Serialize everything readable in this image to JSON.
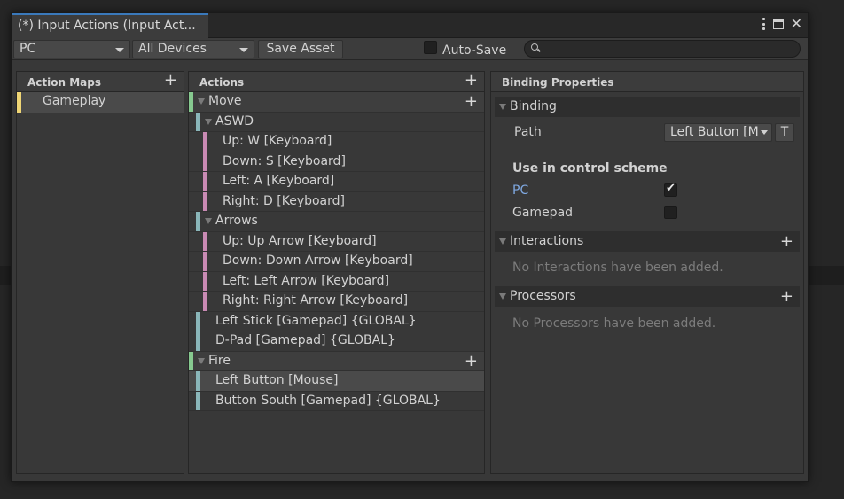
{
  "window": {
    "tab_title": "(*) Input Actions (Input Act..."
  },
  "toolbar": {
    "scheme_value": "PC",
    "device_value": "All Devices",
    "save_label": "Save Asset",
    "autosave_label": "Auto-Save",
    "autosave_checked": false
  },
  "action_maps": {
    "header": "Action Maps",
    "items": [
      {
        "label": "Gameplay",
        "color": "#f0d675"
      }
    ]
  },
  "actions": {
    "header": "Actions",
    "rows": [
      {
        "label": "Move",
        "kind": "action",
        "color": "#86c98f"
      },
      {
        "label": "ASWD",
        "kind": "composite",
        "color": "#8ab6b9"
      },
      {
        "label": "Up: W [Keyboard]",
        "kind": "part",
        "color": "#c98ab4"
      },
      {
        "label": "Down: S [Keyboard]",
        "kind": "part",
        "color": "#c98ab4"
      },
      {
        "label": "Left: A [Keyboard]",
        "kind": "part",
        "color": "#c98ab4"
      },
      {
        "label": "Right: D [Keyboard]",
        "kind": "part",
        "color": "#c98ab4"
      },
      {
        "label": "Arrows",
        "kind": "composite",
        "color": "#8ab6b9"
      },
      {
        "label": "Up: Up Arrow [Keyboard]",
        "kind": "part",
        "color": "#c98ab4"
      },
      {
        "label": "Down: Down Arrow [Keyboard]",
        "kind": "part",
        "color": "#c98ab4"
      },
      {
        "label": "Left: Left Arrow [Keyboard]",
        "kind": "part",
        "color": "#c98ab4"
      },
      {
        "label": "Right: Right Arrow [Keyboard]",
        "kind": "part",
        "color": "#c98ab4"
      },
      {
        "label": "Left Stick [Gamepad] {GLOBAL}",
        "kind": "binding",
        "color": "#8ab6b9"
      },
      {
        "label": "D-Pad [Gamepad] {GLOBAL}",
        "kind": "binding",
        "color": "#8ab6b9"
      },
      {
        "label": "Fire",
        "kind": "action",
        "color": "#86c98f"
      },
      {
        "label": "Left Button [Mouse]",
        "kind": "binding",
        "color": "#8ab6b9",
        "selected": true
      },
      {
        "label": "Button South [Gamepad] {GLOBAL}",
        "kind": "binding",
        "color": "#8ab6b9"
      }
    ]
  },
  "binding_properties": {
    "header": "Binding Properties",
    "binding_section": "Binding",
    "path_label": "Path",
    "path_value": "Left Button [M",
    "t_button": "T",
    "scheme_heading": "Use in control scheme",
    "schemes": [
      {
        "label": "PC",
        "checked": true,
        "accent": "#7fa8e0"
      },
      {
        "label": "Gamepad",
        "checked": false
      }
    ],
    "interactions_section": "Interactions",
    "interactions_empty": "No Interactions have been added.",
    "processors_section": "Processors",
    "processors_empty": "No Processors have been added."
  }
}
